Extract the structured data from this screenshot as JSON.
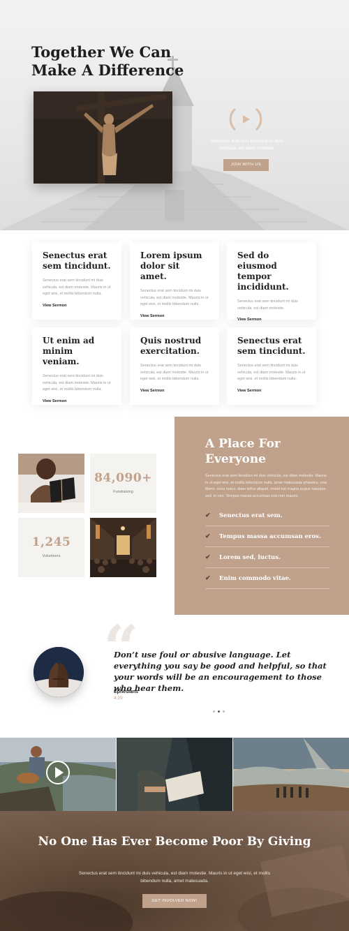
{
  "hero": {
    "title": "Together We Can Make A Difference",
    "caption": "Senectus erat sem tincidunt mi duis vehicula, est diam molestie.",
    "button_label": "JOIN WITH US"
  },
  "sermons": {
    "link_label": "View Sermon",
    "cards": [
      {
        "title": "Senectus erat sem tincidunt.",
        "text": "Senectus erat sem tincidunt mi duis vehicula, est diam molestie. Mauris in ut eget wisi, et mollis bibendum nulla."
      },
      {
        "title": "Lorem ipsum dolor sit amet.",
        "text": "Senectus erat sem tincidunt mi duis vehicula, est diam molestie. Mauris in ut eget wisi, et mollis bibendum nulla."
      },
      {
        "title": "Sed do eiusmod tempor incididunt.",
        "text": "Senectus erat sem tincidunt mi duis vehicula, est diam molestie."
      },
      {
        "title": "Ut enim ad minim veniam.",
        "text": "Senectus erat sem tincidunt mi duis vehicula, est diam molestie. Mauris in ut eget wisi, et mollis bibendum nulla."
      },
      {
        "title": "Quis nostrud exercitation.",
        "text": "Senectus erat sem tincidunt mi duis vehicula, est diam molestie. Mauris in ut eget wisi, et mollis bibendum nulla."
      },
      {
        "title": "Senectus erat sem tincidunt.",
        "text": "Senectus erat sem tincidunt mi duis vehicula, est diam molestie. Mauris in ut eget wisi, et mollis bibendum nulla."
      }
    ]
  },
  "stats": {
    "fundraising": {
      "value": "84,090+",
      "label": "Fundraising"
    },
    "volunteers": {
      "value": "1,245",
      "label": "Volunteers"
    }
  },
  "place": {
    "title": "A Place For Everyone",
    "text": "Senectus erat sem tincidunt mi duis vehicula, est diam molestie. Mauris in ut eget wisi, et mollis bibendum nulla, amet malesuada pharetra, cras libero. cima netus, diam tellus aliquet, morbi est magna augue natoque sed, in nec. Tempus massa accumsan eos non mauris.",
    "items": [
      "Senectus erat sem.",
      "Tempus massa accumsan eros.",
      "Lorem sed, luctus.",
      "Enim commodo vitae."
    ]
  },
  "testimonial": {
    "quote": "Don’t use foul or abusive language. Let everything you say be good and helpful, so that your words will be an encouragement to those who hear them.",
    "author": "Ephesians",
    "reference": "4:29"
  },
  "cta": {
    "title": "No One Has Ever Become Poor By Giving",
    "text": "Senectus erat sem tincidunt mi duis vehicula, est diam molestie. Mauris in ut eget wisi, et mollis bibendum nulla, amet malesuada.",
    "button_label": "GET INVOLVED NOW!"
  },
  "colors": {
    "accent": "#c0a18c",
    "dark": "#1d1d1d"
  }
}
